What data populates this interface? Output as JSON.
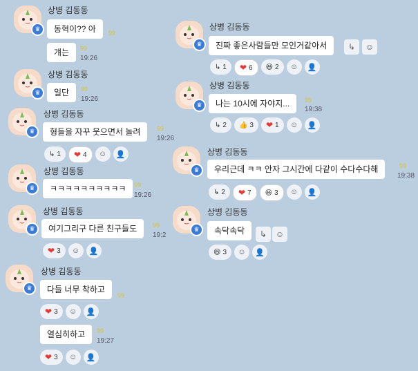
{
  "sender": "상병 김동동",
  "badge_icon": "♛",
  "unread": "99",
  "messages": {
    "m1": {
      "text": "동혁이?? 아"
    },
    "m2": {
      "text": "걔는",
      "time": "19:26"
    },
    "m3": {
      "text": "일단",
      "time": "19:26"
    },
    "m4": {
      "text": "형들을 자꾸 웃으면서 놀려",
      "time": "19:26",
      "reply": "1",
      "heart": "4"
    },
    "m5": {
      "text": "ㅋㅋㅋㅋㅋㅋㅋㅋㅋㅋ",
      "time": "19:26"
    },
    "m6": {
      "text": "여기그리구 다른 친구들도",
      "time": "19:2",
      "heart": "3"
    },
    "m7": {
      "text": "다들 너무 착하고",
      "heart": "3"
    },
    "m8": {
      "text": "열심히하고",
      "time": "19:27",
      "heart": "3"
    },
    "m9": {
      "text": "진짜 좋은사람들만 모인거같아서",
      "reply": "1",
      "heart": "6",
      "laugh": "2"
    },
    "m10": {
      "text": "나는 10시에 자야지...",
      "time": "19:38",
      "reply": "2",
      "thumb": "3",
      "heart": "1"
    },
    "m11": {
      "text": "우리근데 ㅋㅋ 안자 그시간에 다같이 수다수다해",
      "time": "19:38",
      "reply": "2",
      "heart": "7",
      "laugh": "3"
    },
    "m12": {
      "text": "속닥속닥",
      "laugh": "3"
    }
  },
  "icons": {
    "reply": "↳",
    "heart": "❤",
    "thumb": "👍",
    "laugh": "😆",
    "emoji_add": "☺",
    "person": "👤"
  }
}
